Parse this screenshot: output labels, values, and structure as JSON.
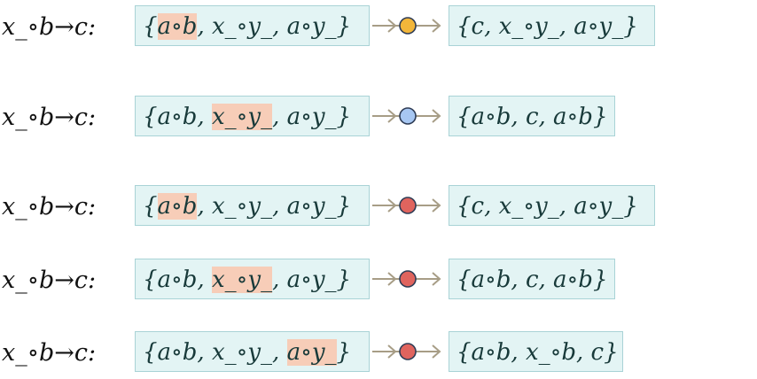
{
  "colors": {
    "box_fill": "#e3f4f4",
    "box_border": "#a9d3d6",
    "highlight": "#f7cdb8",
    "arrow": "#a79d86",
    "node_yellow": "#f2b63a",
    "node_blue": "#a7c7f2",
    "node_red": "#e0645e"
  },
  "rows": [
    {
      "rule": "x_∘b→c:",
      "input": [
        {
          "text": "{",
          "hl": false
        },
        {
          "text": "a∘b",
          "hl": true
        },
        {
          "text": ", x_∘y_, a∘y_}",
          "hl": false
        }
      ],
      "node_color": "yellow",
      "output": "{c, x_∘y_, a∘y_}"
    },
    {
      "rule": "x_∘b→c:",
      "input": [
        {
          "text": "{a∘b, ",
          "hl": false
        },
        {
          "text": "x_∘y_",
          "hl": true
        },
        {
          "text": ", a∘y_}",
          "hl": false
        }
      ],
      "node_color": "blue",
      "output": "{a∘b, c, a∘b}"
    },
    {
      "rule": "x_∘b→c:",
      "input": [
        {
          "text": "{",
          "hl": false
        },
        {
          "text": "a∘b",
          "hl": true
        },
        {
          "text": ", x_∘y_, a∘y_}",
          "hl": false
        }
      ],
      "node_color": "red",
      "output": "{c, x_∘y_, a∘y_}"
    },
    {
      "rule": "x_∘b→c:",
      "input": [
        {
          "text": "{a∘b, ",
          "hl": false
        },
        {
          "text": "x_∘y_",
          "hl": true
        },
        {
          "text": ", a∘y_}",
          "hl": false
        }
      ],
      "node_color": "red",
      "output": "{a∘b, c, a∘b}"
    },
    {
      "rule": "x_∘b→c:",
      "input": [
        {
          "text": "{a∘b, x_∘y_, ",
          "hl": false
        },
        {
          "text": "a∘y_",
          "hl": true
        },
        {
          "text": "}",
          "hl": false
        }
      ],
      "node_color": "red",
      "output": "{a∘b, x_∘b, c}"
    }
  ]
}
